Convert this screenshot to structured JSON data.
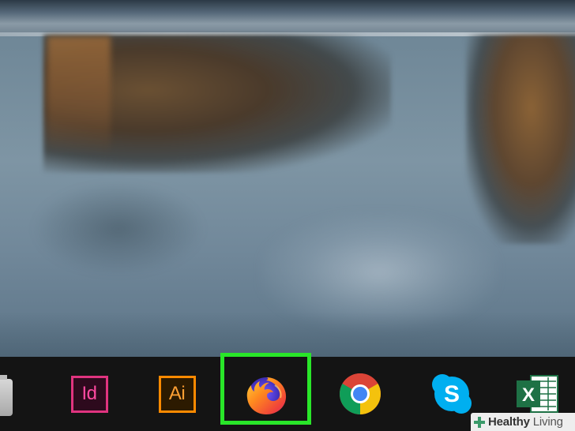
{
  "desktop": {
    "wallpaper": "water-reflection"
  },
  "taskbar": {
    "background": "#141414",
    "items": [
      {
        "name": "file-explorer",
        "icon": "file-explorer-icon",
        "label": ""
      },
      {
        "name": "indesign",
        "icon": "adobe-indesign-icon",
        "label": "Id",
        "color": "#e0347f"
      },
      {
        "name": "illustrator",
        "icon": "adobe-illustrator-icon",
        "label": "Ai",
        "color": "#ff8a00"
      },
      {
        "name": "firefox",
        "icon": "firefox-icon",
        "label": "",
        "highlighted": true
      },
      {
        "name": "chrome",
        "icon": "chrome-icon",
        "label": ""
      },
      {
        "name": "skype",
        "icon": "skype-icon",
        "label": "S",
        "color": "#00aff0"
      },
      {
        "name": "excel",
        "icon": "excel-icon",
        "label": "X",
        "color": "#1e7145"
      }
    ],
    "highlight_color": "#29e629"
  },
  "watermark": {
    "brand_bold": "Healthy",
    "brand_light": "Living"
  }
}
